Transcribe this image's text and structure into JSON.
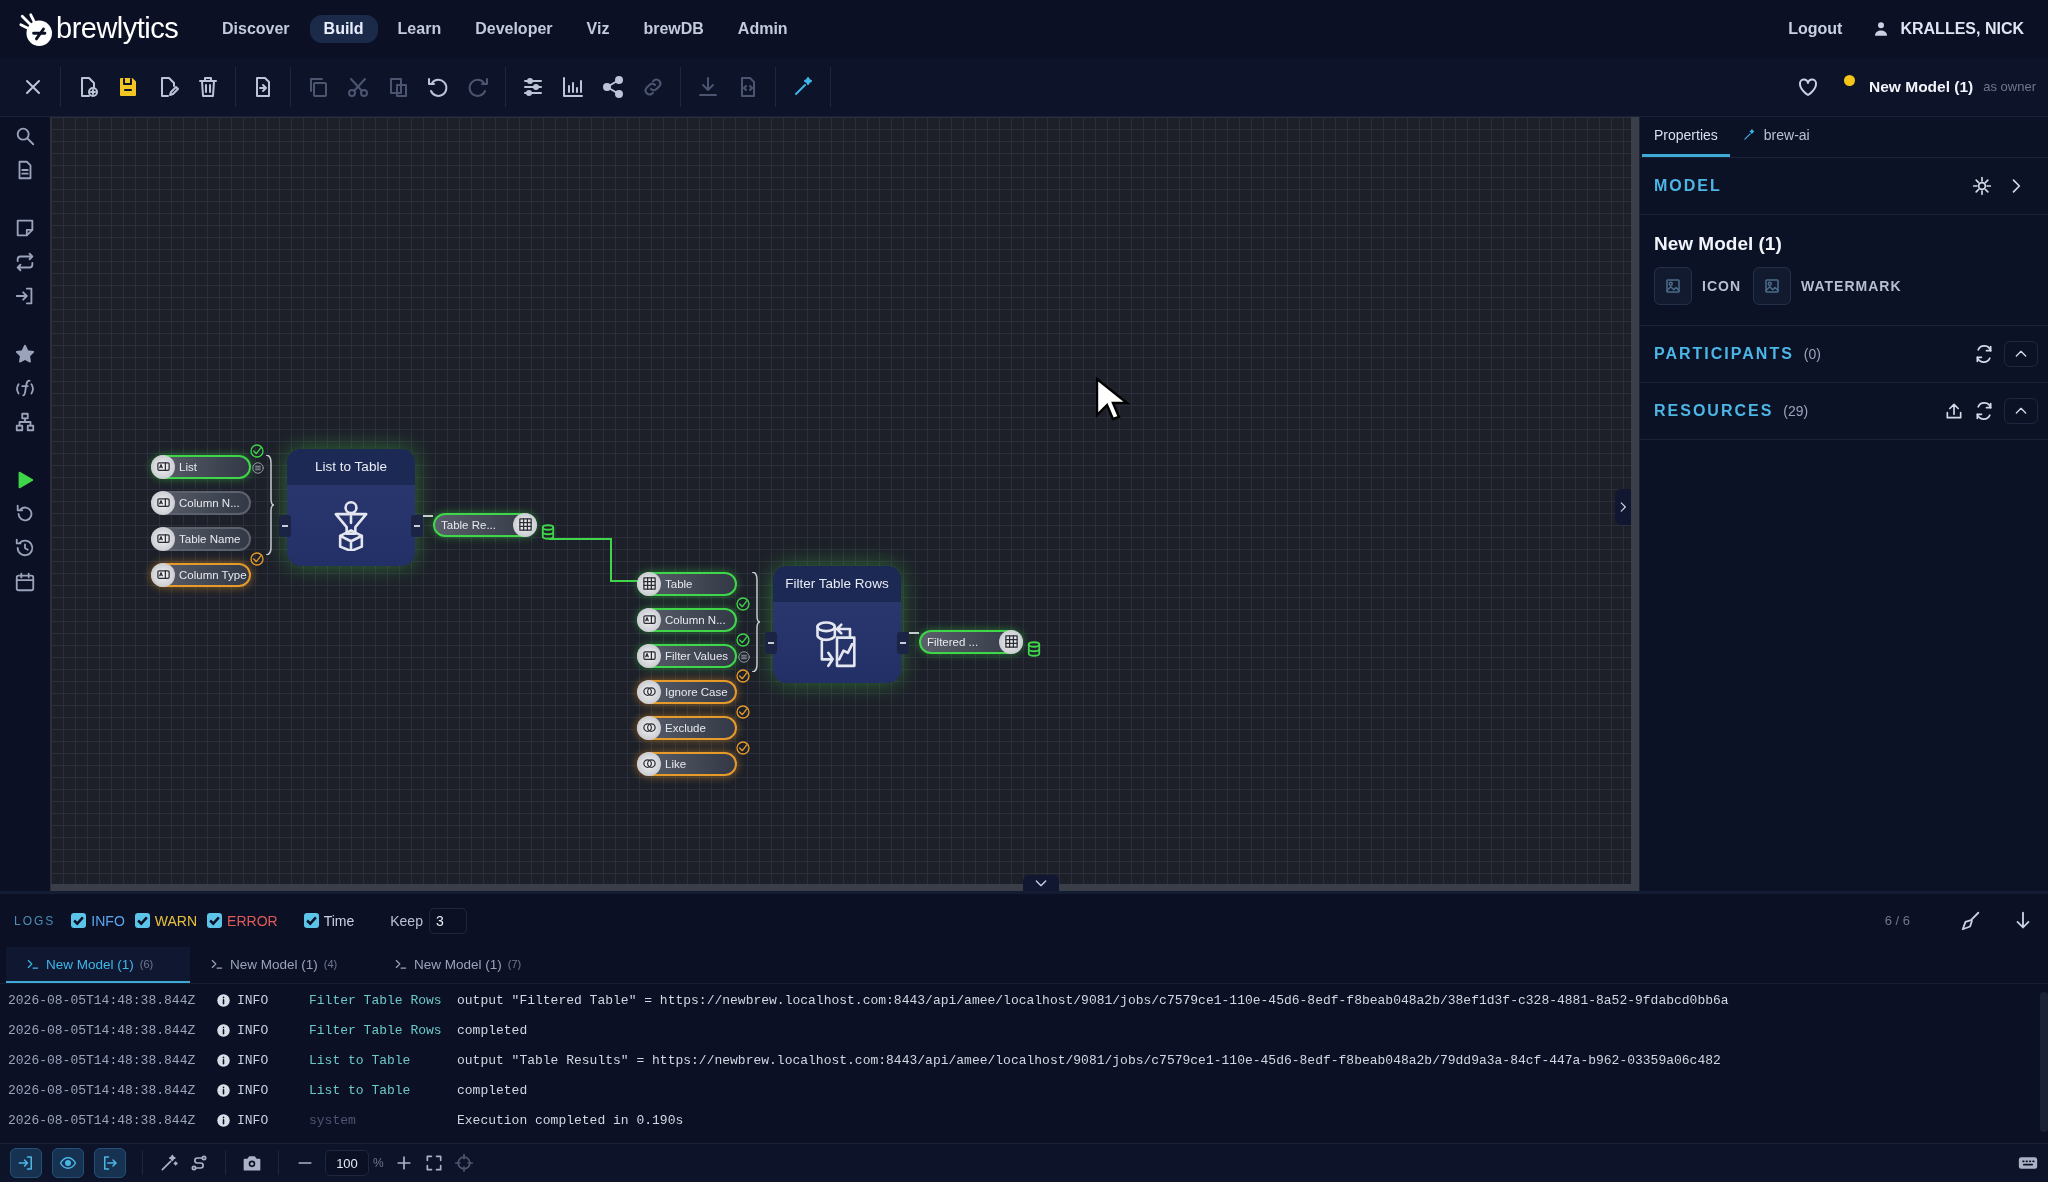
{
  "header": {
    "logo": "**brew**lytics",
    "nav": [
      {
        "label": "Discover",
        "selected": false
      },
      {
        "label": "Build",
        "selected": true
      },
      {
        "label": "Learn",
        "selected": false
      },
      {
        "label": "Developer",
        "selected": false
      },
      {
        "label": "Viz",
        "selected": false
      },
      {
        "label": "brewDB",
        "selected": false
      },
      {
        "label": "Admin",
        "selected": false
      }
    ],
    "logout": "Logout",
    "user": "KRALLES, NICK"
  },
  "toolbar": {
    "groups": [
      [
        {
          "kind": "close",
          "disabled": false
        }
      ],
      [
        {
          "kind": "new-file",
          "disabled": false
        },
        {
          "kind": "save",
          "disabled": false
        },
        {
          "kind": "edit-file",
          "disabled": false
        },
        {
          "kind": "trash",
          "disabled": false
        }
      ],
      [
        {
          "kind": "import-file",
          "disabled": false
        }
      ],
      [
        {
          "kind": "copy",
          "disabled": true
        },
        {
          "kind": "cut",
          "disabled": true
        },
        {
          "kind": "paste",
          "disabled": true
        },
        {
          "kind": "undo",
          "disabled": false
        },
        {
          "kind": "redo",
          "disabled": true
        }
      ],
      [
        {
          "kind": "sliders",
          "disabled": false
        },
        {
          "kind": "bar-chart",
          "disabled": false
        },
        {
          "kind": "share",
          "disabled": false
        },
        {
          "kind": "link",
          "disabled": true
        }
      ],
      [
        {
          "kind": "download",
          "disabled": true
        },
        {
          "kind": "code-file",
          "disabled": true
        }
      ],
      [
        {
          "kind": "sparkle-wand",
          "disabled": false
        }
      ]
    ],
    "model_name": "New Model (1)",
    "role": "as owner",
    "unsaved": true
  },
  "sidebar": [
    {
      "kind": "search"
    },
    {
      "kind": "file-text"
    },
    {
      "kind": "sticky-note"
    },
    {
      "kind": "repeat"
    },
    {
      "kind": "sign-in"
    },
    {
      "kind": "star"
    },
    {
      "kind": "function"
    },
    {
      "kind": "hierarchy"
    },
    {
      "kind": "play"
    },
    {
      "kind": "reset"
    },
    {
      "kind": "history"
    },
    {
      "kind": "calendar"
    }
  ],
  "nodes": [
    {
      "title": "List to Table",
      "kind": "funnel-box",
      "inputs": [
        {
          "label": "List",
          "kind": "text",
          "connected": true,
          "defaulted": false,
          "valid": true,
          "list": true
        },
        {
          "label": "Column N...",
          "kind": "text",
          "connected": false,
          "defaulted": false,
          "valid": false,
          "list": false
        },
        {
          "label": "Table Name",
          "kind": "text",
          "connected": false,
          "defaulted": false,
          "valid": false,
          "list": false
        },
        {
          "label": "Column Type",
          "kind": "text",
          "connected": false,
          "defaulted": true,
          "valid": false,
          "list": false
        }
      ],
      "outputs": [
        {
          "label": "Table Re...",
          "kind": "table",
          "connected": true
        }
      ]
    },
    {
      "title": "Filter Table Rows",
      "kind": "filter-chart",
      "inputs": [
        {
          "label": "Table",
          "kind": "table",
          "connected": true,
          "defaulted": false,
          "valid": false,
          "list": false
        },
        {
          "label": "Column N...",
          "kind": "text",
          "connected": true,
          "defaulted": false,
          "valid": true,
          "list": false
        },
        {
          "label": "Filter Values",
          "kind": "text",
          "connected": true,
          "defaulted": false,
          "valid": true,
          "list": true
        },
        {
          "label": "Ignore Case",
          "kind": "bool",
          "connected": false,
          "defaulted": true,
          "valid": false,
          "list": false
        },
        {
          "label": "Exclude",
          "kind": "bool",
          "connected": false,
          "defaulted": true,
          "valid": false,
          "list": false
        },
        {
          "label": "Like",
          "kind": "bool",
          "connected": false,
          "defaulted": true,
          "valid": false,
          "list": false
        }
      ],
      "outputs": [
        {
          "label": "Filtered ...",
          "kind": "table",
          "connected": true
        }
      ]
    }
  ],
  "panel": {
    "tabs": [
      {
        "label": "Properties",
        "selected": true
      },
      {
        "label": "brew-ai",
        "selected": false
      }
    ],
    "model": {
      "heading": "MODEL",
      "name": "New Model (1)",
      "assets": [
        "ICON",
        "WATERMARK"
      ]
    },
    "sections": [
      {
        "title": "PARTICIPANTS",
        "count": "(0)",
        "expanded": true,
        "can_upload": false
      },
      {
        "title": "RESOURCES",
        "count": "(29)",
        "expanded": true,
        "can_upload": true
      }
    ]
  },
  "logs": {
    "title": "LOGS",
    "filters": [
      {
        "label": "INFO",
        "kind": "info",
        "checked": true
      },
      {
        "label": "WARN",
        "kind": "warn",
        "checked": true
      },
      {
        "label": "ERROR",
        "kind": "error",
        "checked": true
      },
      {
        "label": "Time",
        "kind": "time",
        "checked": true
      }
    ],
    "keep_label": "Keep",
    "keep": "3",
    "counter": "6 / 6",
    "tabs": [
      {
        "label": "New Model (1)",
        "count": "(6)",
        "selected": true
      },
      {
        "label": "New Model (1)",
        "count": "(4)",
        "selected": false
      },
      {
        "label": "New Model (1)",
        "count": "(7)",
        "selected": false
      }
    ],
    "rows": [
      {
        "time": "2026-08-05T14:48:38.844Z",
        "level": "INFO",
        "source": "Filter Table Rows",
        "kind": "node",
        "message": "output \"Filtered Table\" = https://newbrew.localhost.com:8443/api/amee/localhost/9081/jobs/c7579ce1-110e-45d6-8edf-f8beab048a2b/38ef1d3f-c328-4881-8a52-9fdabcd0bb6a"
      },
      {
        "time": "2026-08-05T14:48:38.844Z",
        "level": "INFO",
        "source": "Filter Table Rows",
        "kind": "node",
        "message": "completed"
      },
      {
        "time": "2026-08-05T14:48:38.844Z",
        "level": "INFO",
        "source": "List to Table",
        "kind": "node",
        "message": "output \"Table Results\" = https://newbrew.localhost.com:8443/api/amee/localhost/9081/jobs/c7579ce1-110e-45d6-8edf-f8beab048a2b/79dd9a3a-84cf-447a-b962-03359a06c482"
      },
      {
        "time": "2026-08-05T14:48:38.844Z",
        "level": "INFO",
        "source": "List to Table",
        "kind": "node",
        "message": "completed"
      },
      {
        "time": "2026-08-05T14:48:38.844Z",
        "level": "INFO",
        "source": "system",
        "kind": "system",
        "message": "Execution completed in 0.190s"
      }
    ]
  },
  "bottom_bar": {
    "toggles": [
      {
        "kind": "sign-in",
        "selected": true
      },
      {
        "kind": "eye",
        "selected": true
      },
      {
        "kind": "sign-out",
        "selected": true
      }
    ],
    "zoom": "100",
    "zoom_unit": "%"
  }
}
